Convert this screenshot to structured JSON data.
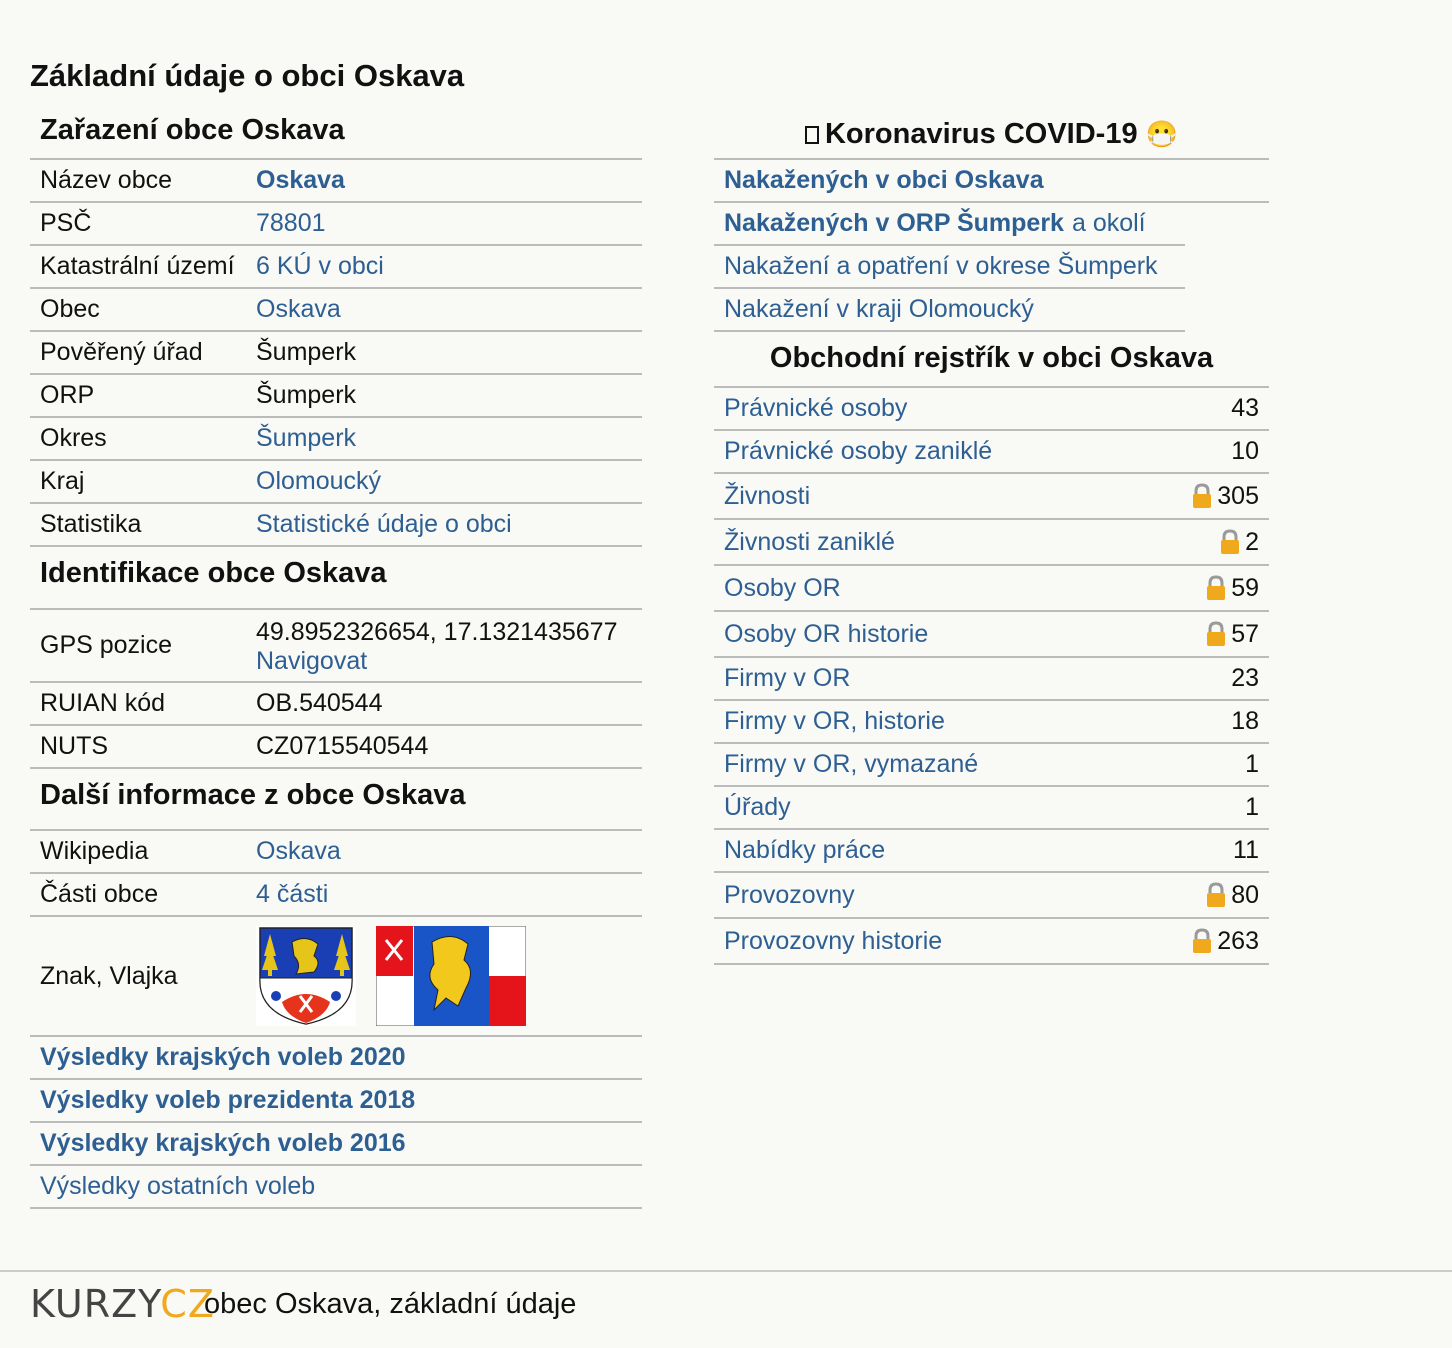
{
  "page_title": "Základní údaje o obci Oskava",
  "zarazeni": {
    "title": "Zařazení obce Oskava",
    "rows": [
      {
        "label": "Název obce",
        "value": "Oskava"
      },
      {
        "label": "PSČ",
        "value": "78801"
      },
      {
        "label": "Katastrální území",
        "value": "6 KÚ v obci"
      },
      {
        "label": "Obec",
        "value": "Oskava"
      },
      {
        "label": "Pověřený úřad",
        "value": "Šumperk"
      },
      {
        "label": "ORP",
        "value": "Šumperk"
      },
      {
        "label": "Okres",
        "value": "Šumperk"
      },
      {
        "label": "Kraj",
        "value": "Olomoucký"
      },
      {
        "label": "Statistika",
        "value": "Statistické údaje o obci"
      }
    ]
  },
  "identifikace": {
    "title": "Identifikace obce Oskava",
    "gps_label": "GPS pozice",
    "gps_value": "49.8952326654, 17.1321435677",
    "gps_link": "Navigovat",
    "ruian_label": "RUIAN kód",
    "ruian_value": "OB.540544",
    "nuts_label": "NUTS",
    "nuts_value": "CZ0715540544"
  },
  "dalsi": {
    "title": "Další informace z obce Oskava",
    "wiki_label": "Wikipedia",
    "wiki_value": "Oskava",
    "casti_label": "Části obce",
    "casti_value": "4 části",
    "znak_label": "Znak, Vlajka"
  },
  "volby": [
    {
      "label": "Výsledky krajských voleb 2020"
    },
    {
      "label": "Výsledky voleb prezidenta 2018"
    },
    {
      "label": "Výsledky krajských voleb 2016"
    },
    {
      "label": "Výsledky ostatních voleb"
    }
  ],
  "covid": {
    "title": "Koronavirus COVID-19",
    "title_icon": "virus-icon",
    "title_emoji": "😷",
    "rows": {
      "obec": "Nakažených v obci Oskava",
      "orp_bold": "Nakažených v ORP Šumperk",
      "orp_rest": "a okolí",
      "okres": "Nakažení a opatření v okrese Šumperk",
      "kraj": "Nakažení v kraji Olomoucký"
    }
  },
  "rejstrik": {
    "title": "Obchodní rejstřík v obci Oskava",
    "rows": [
      {
        "label": "Právnické osoby",
        "count": "43",
        "locked": false
      },
      {
        "label": "Právnické osoby zaniklé",
        "count": "10",
        "locked": false
      },
      {
        "label": "Živnosti",
        "count": "305",
        "locked": true
      },
      {
        "label": "Živnosti zaniklé",
        "count": "2",
        "locked": true
      },
      {
        "label": "Osoby OR",
        "count": "59",
        "locked": true
      },
      {
        "label": "Osoby OR historie",
        "count": "57",
        "locked": true
      },
      {
        "label": "Firmy v OR",
        "count": "23",
        "locked": false
      },
      {
        "label": "Firmy v OR, historie",
        "count": "18",
        "locked": false
      },
      {
        "label": "Firmy v OR, vymazané",
        "count": "1",
        "locked": false
      },
      {
        "label": "Úřady",
        "count": "1",
        "locked": false
      },
      {
        "label": "Nabídky práce",
        "count": "11",
        "locked": false
      },
      {
        "label": "Provozovny",
        "count": "80",
        "locked": true
      },
      {
        "label": "Provozovny historie",
        "count": "263",
        "locked": true
      }
    ]
  },
  "footer": {
    "logo_part1": "KURZY",
    "logo_part2": "CZ",
    "text": "obec Oskava, základní údaje"
  },
  "colors": {
    "link": "#2d5f93",
    "background": "#f9f9f5",
    "lock": "#f0a81c"
  }
}
